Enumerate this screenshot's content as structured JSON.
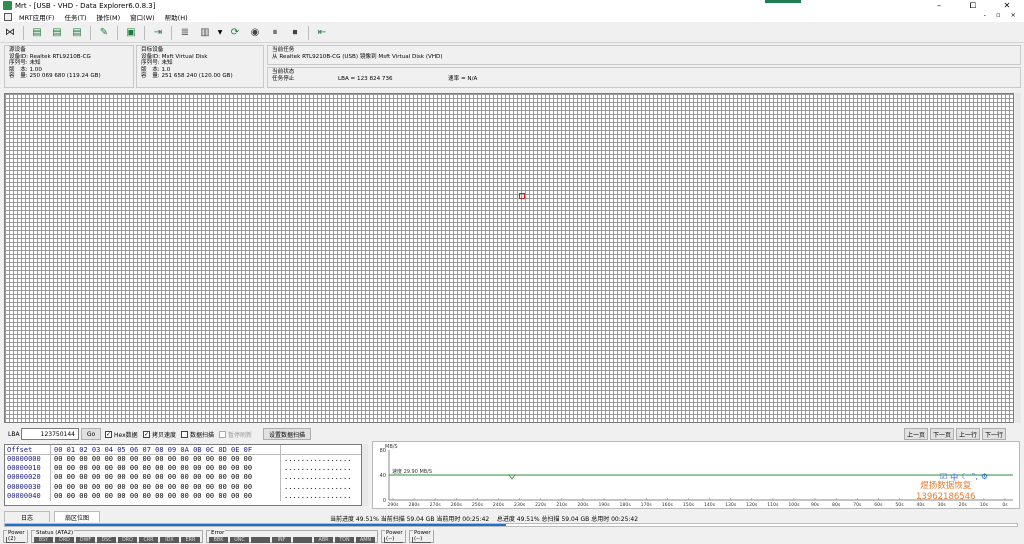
{
  "window": {
    "title": "Mrt - [USB - VHD - Data Explorer6.0.8.3]",
    "controls": [
      "–",
      "⧠",
      "✕"
    ],
    "mdi_controls": "- ▫ ×"
  },
  "menu": [
    "MRT应用(F)",
    "任务(T)",
    "操作(M)",
    "窗口(W)",
    "帮助(H)"
  ],
  "source_device": {
    "heading": "源设备",
    "device_id": "设备ID: Realtek RTL9210B-CG",
    "serial": "序列号: 未知",
    "version": "版　本: 1.00",
    "capacity": "容　量: 250 069 680 (119.24 GB)"
  },
  "target_device": {
    "heading": "目标设备",
    "device_id": "设备ID: Msft Virtual Disk",
    "serial": "序列号: 未知",
    "version": "版　本: 1.0",
    "capacity": "容　量: 251 658 240 (120.00 GB)"
  },
  "current_task": {
    "heading": "当前任务",
    "text": "从 Realtek RTL9210B-CG (USB) 镜像到 Msft Virtual Disk (VHD)"
  },
  "current_status": {
    "heading": "当前状态",
    "state": "任务停止",
    "lba": "LBA = 123 824 736",
    "speed": "速率 = N/A"
  },
  "controls": {
    "lba_label": "LBA",
    "lba_value": "123750144",
    "go_label": "Go",
    "hex_label": "Hex数据",
    "hex_checked": true,
    "copy_speed_label": "拷贝速度",
    "copy_speed_checked": true,
    "data_scan_label": "数据扫描",
    "data_scan_checked": false,
    "pause_refresh_label": "暂停刷新",
    "pause_refresh_checked": false,
    "set_scan_label": "设置数据扫描",
    "prev_page": "上一页",
    "next_page": "下一页",
    "prev_line": "上一行",
    "next_line": "下一行"
  },
  "hex": {
    "header_offset": "Offset",
    "header_bytes": "00 01 02 03 04 05 06 07 08 09 0A 0B 0C 0D 0E 0F",
    "rows": [
      {
        "offset": "00000000",
        "bytes": "00 00 00 00 00 00 00 00 00 00 00 00 00 00 00 00",
        "ascii": "................"
      },
      {
        "offset": "00000010",
        "bytes": "00 00 00 00 00 00 00 00 00 00 00 00 00 00 00 00",
        "ascii": "................"
      },
      {
        "offset": "00000020",
        "bytes": "00 00 00 00 00 00 00 00 00 00 00 00 00 00 00 00",
        "ascii": "................"
      },
      {
        "offset": "00000030",
        "bytes": "00 00 00 00 00 00 00 00 00 00 00 00 00 00 00 00",
        "ascii": "................"
      },
      {
        "offset": "00000040",
        "bytes": "00 00 00 00 00 00 00 00 00 00 00 00 00 00 00 00",
        "ascii": "................"
      }
    ]
  },
  "speed_chart": {
    "ylabel": "MB/S",
    "y_ticks": [
      "80",
      "40",
      "0"
    ],
    "speed_label": "速度 29.90 MB/S",
    "x_ticks": [
      "290s",
      "280s",
      "270s",
      "260s",
      "250s",
      "240s",
      "230s",
      "220s",
      "210s",
      "200s",
      "190s",
      "180s",
      "170s",
      "160s",
      "150s",
      "140s",
      "130s",
      "120s",
      "110s",
      "100s",
      "90s",
      "80s",
      "70s",
      "60s",
      "50s",
      "40s",
      "30s",
      "20s",
      "10s",
      "0s"
    ],
    "line_value": 40
  },
  "watermark": {
    "line1": "煜扬数据恢复",
    "line2": "13962186546"
  },
  "tabs": [
    "日志",
    "扇区位图"
  ],
  "progress": {
    "text": "当前进度 49.51% 当前扫描 59.04 GB 当前用时 00:25:42    总进度 49.51% 总扫描 59.04 GB 总用时 00:25:42",
    "fraction": 0.4951
  },
  "status_groups": [
    {
      "label": "Power (2)",
      "leds": [
        "OFF"
      ]
    },
    {
      "label": "Status (ATA2)",
      "leds": [
        "BSY",
        "DRD",
        "DWF",
        "DSC",
        "DRQ",
        "CRR",
        "IDX",
        "ERR"
      ]
    },
    {
      "label": "Error",
      "leds": [
        "BBK",
        "UNC",
        "",
        "INF",
        "",
        "ABR",
        "TON",
        "AMN"
      ]
    },
    {
      "label": "Power (--)",
      "leds": [
        "OFF"
      ]
    },
    {
      "label": "Power (--)",
      "leds": [
        "OFF"
      ]
    }
  ]
}
